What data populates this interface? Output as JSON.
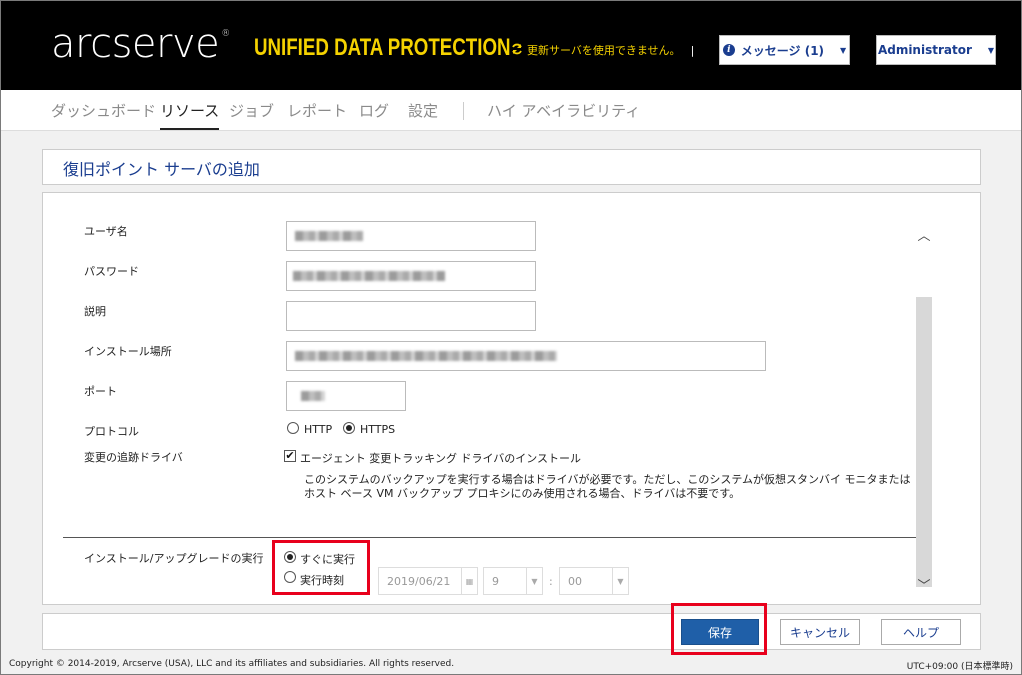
{
  "header": {
    "logo": "arcserve",
    "logo_mark": "®",
    "product": "UNIFIED DATA PROTECTION",
    "update_notice": "更新サーバを使用できません。",
    "update_sep": "|",
    "messages_label": "メッセージ (1)",
    "admin_label": "Administrator"
  },
  "nav": {
    "items": [
      "ダッシュボード",
      "リソース",
      "ジョブ",
      "レポート",
      "ログ",
      "設定",
      "ハイ アベイラビリティ"
    ],
    "active": "リソース"
  },
  "dialog": {
    "title": "復旧ポイント サーバの追加",
    "fields": {
      "username_label": "ユーザ名",
      "password_label": "パスワード",
      "description_label": "説明",
      "install_path_label": "インストール場所",
      "port_label": "ポート",
      "protocol_label": "プロトコル",
      "protocol_options": [
        "HTTP",
        "HTTPS"
      ],
      "protocol_selected": "HTTPS",
      "driver_label": "変更の追跡ドライバ",
      "driver_checkbox_label": "エージェント 変更トラッキング ドライバのインストール",
      "driver_checked": true,
      "driver_note": "このシステムのバックアップを実行する場合はドライバが必要です。ただし、このシステムが仮想スタンバイ モニタまたはホスト ベース VM バックアップ プロキシにのみ使用される場合、ドライバは不要です。",
      "run_label": "インストール/アップグレードの実行",
      "run_options": [
        "すぐに実行",
        "実行時刻"
      ],
      "run_selected": "すぐに実行",
      "schedule_date": "2019/06/21",
      "schedule_hour": "9",
      "schedule_colon": ":",
      "schedule_minute": "00"
    }
  },
  "buttons": {
    "save": "保存",
    "cancel": "キャンセル",
    "help": "ヘルプ"
  },
  "footer": {
    "copyright": "Copyright © 2014-2019, Arcserve (USA), LLC and its affiliates and subsidiaries. All rights reserved.",
    "timezone": "UTC+09:00 (日本標準時)"
  },
  "colors": {
    "accent": "#f5d200",
    "primary_button": "#1f5fa8",
    "highlight": "#e8001c"
  }
}
